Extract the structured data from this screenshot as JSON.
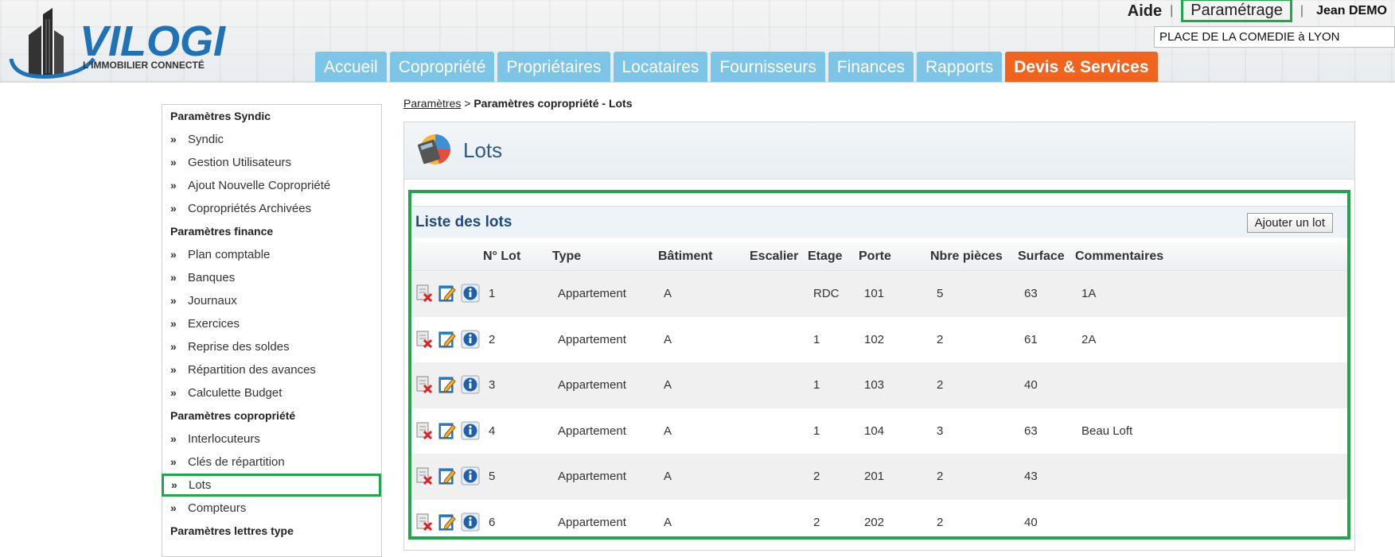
{
  "header": {
    "logo_text": "VILOGI",
    "logo_tagline": "L'IMMOBILIER CONNECTÉ",
    "top_links": {
      "aide": "Aide",
      "separator": "|",
      "parametrage": "Paramétrage",
      "user": "Jean DEMO"
    },
    "copropriete_selected": "PLACE DE LA COMEDIE à LYON",
    "tabs": [
      {
        "label": "Accueil"
      },
      {
        "label": "Copropriété"
      },
      {
        "label": "Propriétaires"
      },
      {
        "label": "Locataires"
      },
      {
        "label": "Fournisseurs"
      },
      {
        "label": "Finances"
      },
      {
        "label": "Rapports"
      },
      {
        "label": "Devis & Services"
      }
    ]
  },
  "sidebar": {
    "chevron": "»",
    "sections": [
      {
        "title": "Paramètres Syndic",
        "items": [
          "Syndic",
          "Gestion Utilisateurs",
          "Ajout Nouvelle Copropriété",
          "Copropriétés Archivées"
        ]
      },
      {
        "title": "Paramètres finance",
        "items": [
          "Plan comptable",
          "Banques",
          "Journaux",
          "Exercices",
          "Reprise des soldes",
          "Répartition des avances",
          "Calculette Budget"
        ]
      },
      {
        "title": "Paramètres copropriété",
        "items": [
          "Interlocuteurs",
          "Clés de répartition",
          "Lots",
          "Compteurs"
        ]
      },
      {
        "title": "Paramètres lettres type",
        "items": []
      }
    ],
    "active_item": "Lots"
  },
  "breadcrumb": {
    "link": "Paramètres",
    "separator": ">",
    "current": "Paramètres copropriété - Lots"
  },
  "panel": {
    "title": "Lots"
  },
  "lots": {
    "list_title": "Liste des lots",
    "add_button": "Ajouter un lot",
    "columns": [
      "N° Lot",
      "Type",
      "Bâtiment",
      "Escalier",
      "Etage",
      "Porte",
      "Nbre pièces",
      "Surface",
      "Commentaires"
    ],
    "rows": [
      {
        "num": "1",
        "type": "Appartement",
        "batiment": "A",
        "escalier": "",
        "etage": "RDC",
        "porte": "101",
        "pieces": "5",
        "surface": "63",
        "commentaire": "1A"
      },
      {
        "num": "2",
        "type": "Appartement",
        "batiment": "A",
        "escalier": "",
        "etage": "1",
        "porte": "102",
        "pieces": "2",
        "surface": "61",
        "commentaire": "2A"
      },
      {
        "num": "3",
        "type": "Appartement",
        "batiment": "A",
        "escalier": "",
        "etage": "1",
        "porte": "103",
        "pieces": "2",
        "surface": "40",
        "commentaire": ""
      },
      {
        "num": "4",
        "type": "Appartement",
        "batiment": "A",
        "escalier": "",
        "etage": "1",
        "porte": "104",
        "pieces": "3",
        "surface": "63",
        "commentaire": "Beau Loft"
      },
      {
        "num": "5",
        "type": "Appartement",
        "batiment": "A",
        "escalier": "",
        "etage": "2",
        "porte": "201",
        "pieces": "2",
        "surface": "43",
        "commentaire": ""
      },
      {
        "num": "6",
        "type": "Appartement",
        "batiment": "A",
        "escalier": "",
        "etage": "2",
        "porte": "202",
        "pieces": "2",
        "surface": "40",
        "commentaire": ""
      }
    ]
  },
  "colors": {
    "tab_blue": "#7cc5e6",
    "tab_orange": "#f0641e",
    "highlight_green": "#1fa84a",
    "title_blue": "#1d4d80"
  }
}
